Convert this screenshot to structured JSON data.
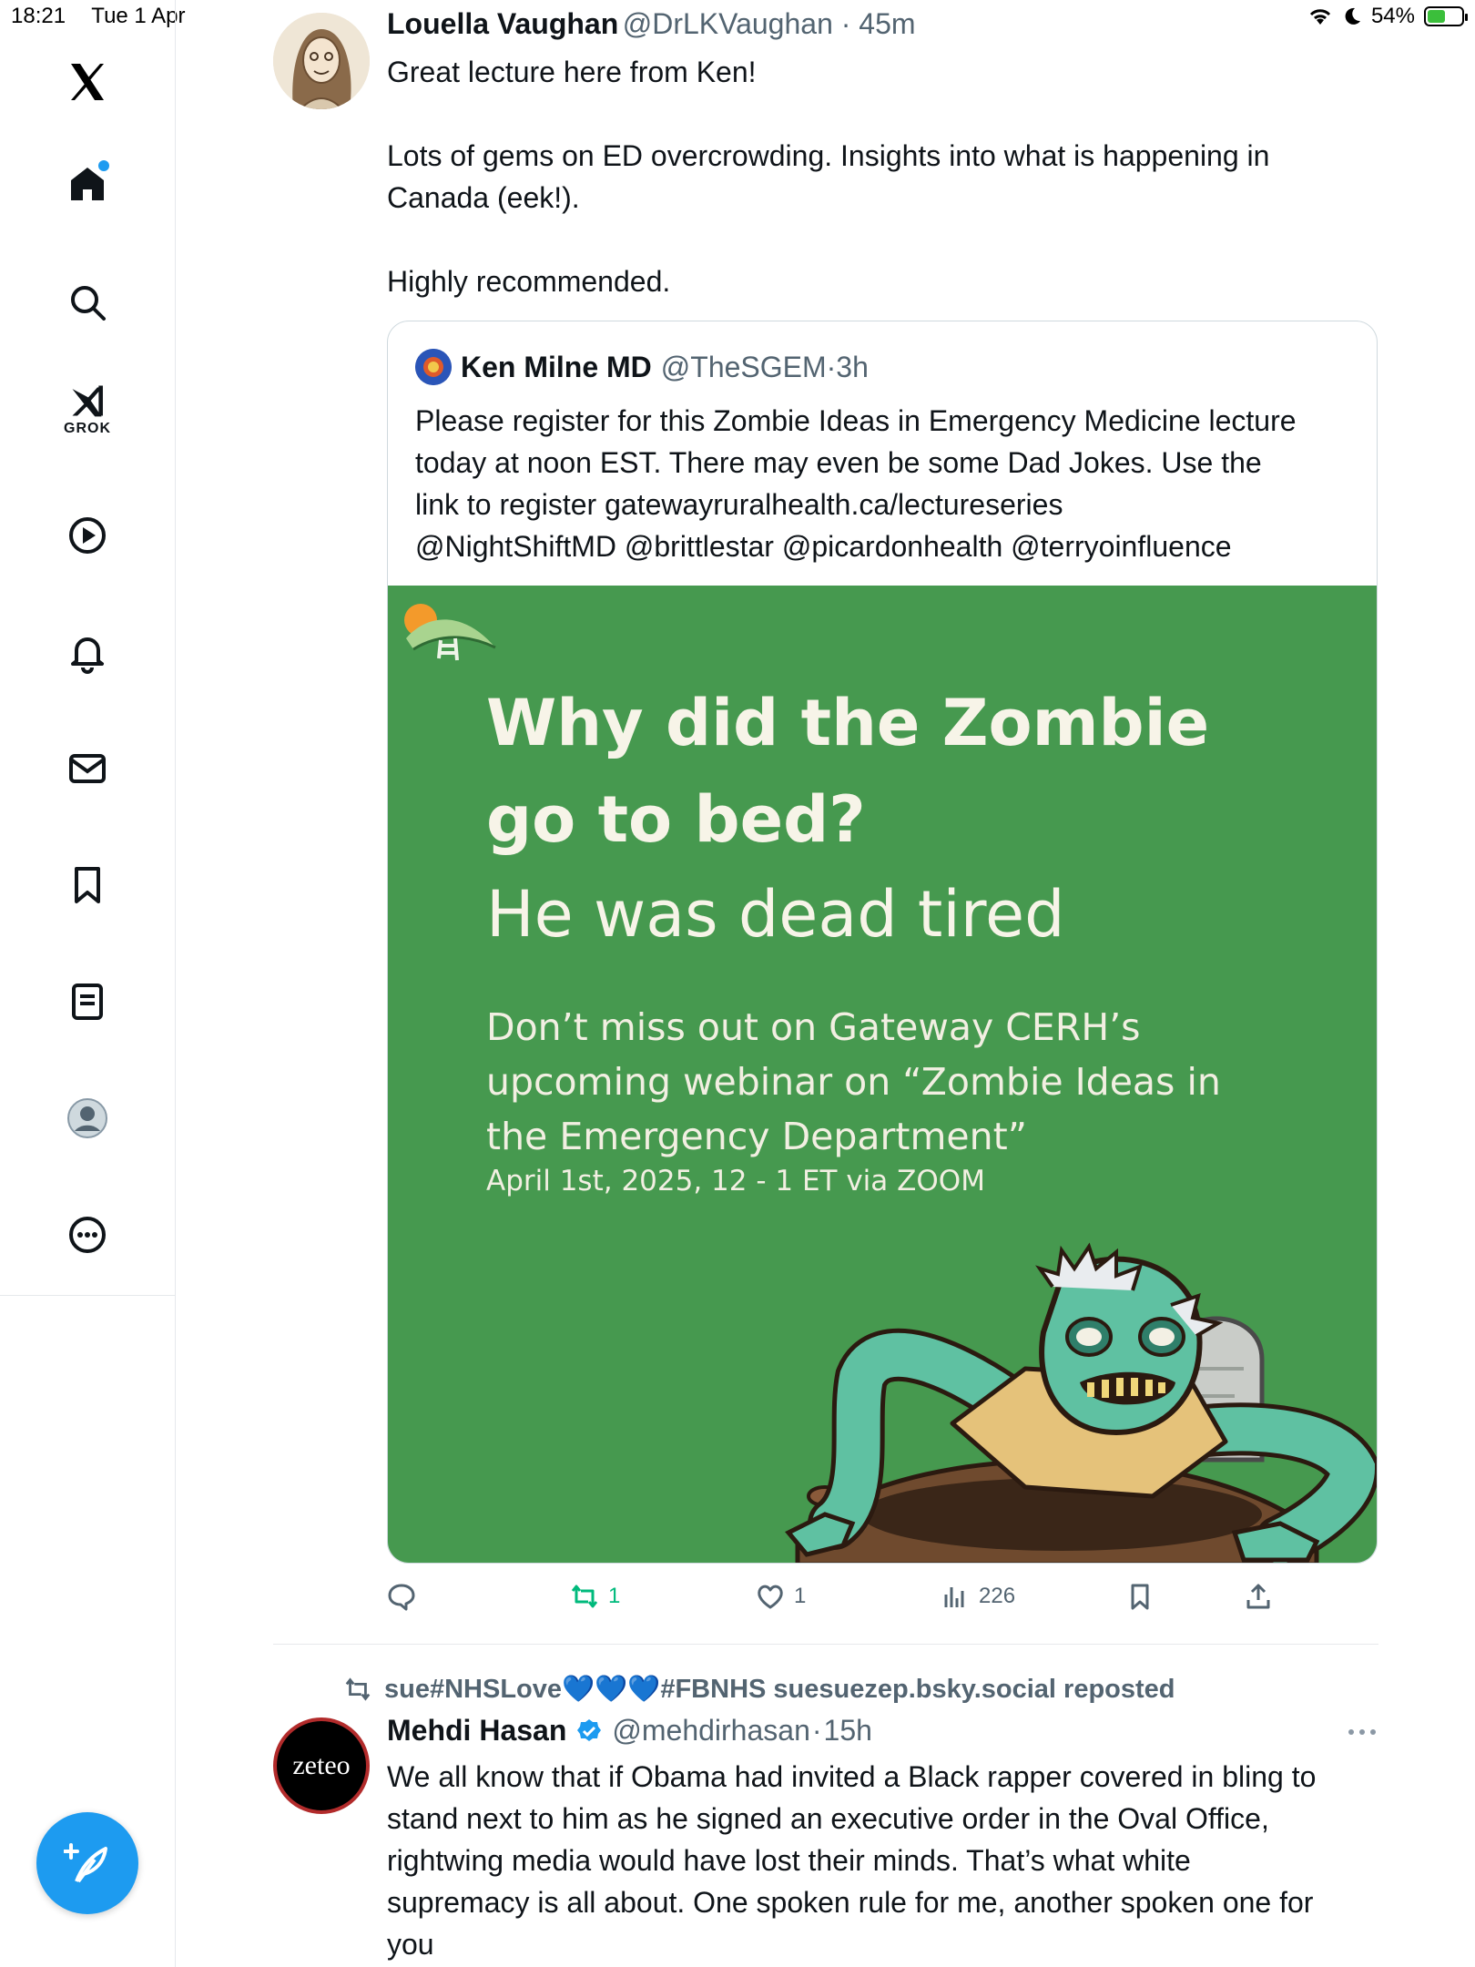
{
  "status_bar": {
    "time": "18:21",
    "date": "Tue 1 Apr",
    "battery": "54%",
    "battery_level": 0.54
  },
  "sidebar": {
    "items": [
      {
        "icon": "x-logo-icon"
      },
      {
        "icon": "home-icon"
      },
      {
        "icon": "search-icon"
      },
      {
        "icon": "grok-icon",
        "label": "GROK"
      },
      {
        "icon": "video-play-icon"
      },
      {
        "icon": "bell-icon"
      },
      {
        "icon": "mail-icon"
      },
      {
        "icon": "bookmark-icon"
      },
      {
        "icon": "list-icon"
      },
      {
        "icon": "profile-icon"
      },
      {
        "icon": "more-icon"
      }
    ],
    "compose_icon": "compose-feather-icon"
  },
  "tweet1": {
    "name": "Louella Vaughan",
    "handle": "@DrLKVaughan",
    "time": "45m",
    "text_lines": [
      "Great lecture here from Ken!",
      "Lots of gems on ED overcrowding. Insights into what is happening in",
      "Canada (eek!).",
      "Highly recommended."
    ],
    "quote": {
      "name": "Ken Milne MD",
      "handle": "@TheSGEM",
      "time": "3h",
      "text_lines": [
        "Please register for this Zombie Ideas in Emergency Medicine lecture",
        "today at noon EST. There may even be some Dad Jokes.  Use the",
        "link to register gatewayruralhealth.ca/lectureseries",
        "@NightShiftMD @brittlestar @picardonhealth @terryoinfluence"
      ],
      "image": {
        "heading1": "Why did the Zombie",
        "heading2": "go to bed?",
        "punchline": "He was dead tired",
        "promo_lines": [
          "Don’t miss out on Gateway CERH’s",
          "upcoming webinar on “Zombie Ideas in",
          "the Emergency Department”"
        ],
        "date": "April 1st, 2025, 12 - 1 ET via ZOOM"
      }
    },
    "actions": {
      "replies": "",
      "reposts": "1",
      "likes": "1",
      "views": "226"
    }
  },
  "tweet2": {
    "reposted_by": "sue#NHSLove💙💙💙#FBNHS suesuezep.bsky.social reposted",
    "name": "Mehdi Hasan",
    "handle": "@mehdirhasan",
    "time": "15h",
    "avatar_text": "zeteo",
    "text_lines": [
      "We all know that if Obama had invited a Black rapper covered in bling to",
      "stand next to him as he signed an executive order in the Oval Office,",
      "rightwing media would have lost their minds. That’s what white",
      "supremacy is all about. One spoken rule for me, another spoken one for",
      "you"
    ]
  },
  "colors": {
    "accent": "#1d9bf0",
    "promo_green": "#46994f",
    "repost_green": "#00ba7c"
  }
}
